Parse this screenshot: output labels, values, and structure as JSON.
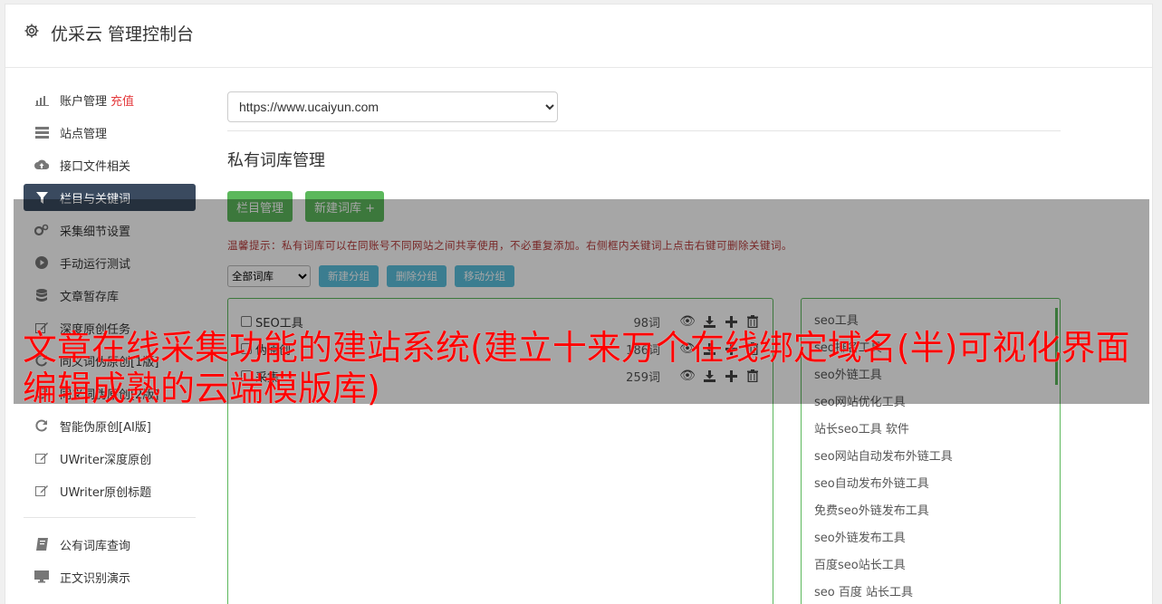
{
  "header": {
    "title": "优采云 管理控制台",
    "icon": "gear-icon"
  },
  "sidebar": {
    "items": [
      {
        "label": "账户管理",
        "badge": "充值",
        "icon": "bar-chart-icon"
      },
      {
        "label": "站点管理",
        "icon": "server-icon"
      },
      {
        "label": "接口文件相关",
        "icon": "cloud-upload-icon"
      },
      {
        "label": "栏目与关键词",
        "icon": "filter-icon",
        "active": true
      },
      {
        "label": "采集细节设置",
        "icon": "cogs-icon"
      },
      {
        "label": "手动运行测试",
        "icon": "play-circle-icon"
      },
      {
        "label": "文章暂存库",
        "icon": "database-icon"
      },
      {
        "label": "深度原创任务",
        "icon": "edit-icon"
      },
      {
        "label": "同义词伪原创[1版]",
        "icon": "refresh-icon"
      },
      {
        "label": "同义词伪原创[2版]",
        "icon": "refresh-icon"
      },
      {
        "label": "智能伪原创[AI版]",
        "icon": "refresh-icon"
      },
      {
        "label": "UWriter深度原创",
        "icon": "edit-icon"
      },
      {
        "label": "UWriter原创标题",
        "icon": "edit-icon"
      }
    ],
    "items2": [
      {
        "label": "公有词库查询",
        "icon": "book-icon"
      },
      {
        "label": "正文识别演示",
        "icon": "monitor-icon"
      }
    ]
  },
  "main": {
    "site_select": "https://www.ucaiyun.com",
    "section_title": "私有词库管理",
    "btn_columns": "栏目管理",
    "btn_new_lib": "新建词库 +",
    "tip": "温馨提示：私有词库可以在同账号不同网站之间共享使用，不必重复添加。右侧框内关键词上点击右键可删除关键词。",
    "lib_filter": "全部词库",
    "btn_new_group": "新建分组",
    "btn_delete_group": "删除分组",
    "btn_move_group": "移动分组",
    "libraries": [
      {
        "name": "SEO工具",
        "count": "98词"
      },
      {
        "name": "伪原创",
        "count": "186词"
      },
      {
        "name": "采集",
        "count": "259词"
      }
    ],
    "keywords": [
      "seo工具",
      "seo排名工具",
      "seo外链工具",
      "seo网站优化工具",
      "站长seo工具 软件",
      "seo网站自动发布外链工具",
      "seo自动发布外链工具",
      "免费seo外链发布工具",
      "seo外链发布工具",
      "百度seo站长工具",
      "seo 百度 站长工具"
    ]
  },
  "overlay": {
    "headline": "文章在线采集功能的建站系统(建立十来万个在线绑定域名(半)可视化界面编辑成熟的云端模版库)"
  }
}
